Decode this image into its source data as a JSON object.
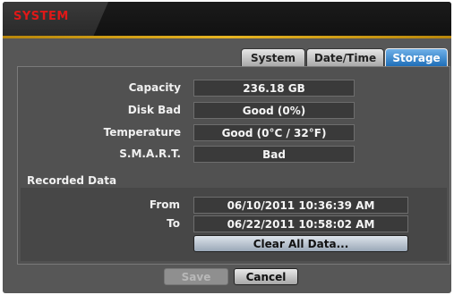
{
  "window": {
    "title": "SYSTEM"
  },
  "tabs": [
    {
      "label": "System",
      "active": false
    },
    {
      "label": "Date/Time",
      "active": false
    },
    {
      "label": "Storage",
      "active": true
    }
  ],
  "storage": {
    "capacity_label": "Capacity",
    "capacity_value": "236.18 GB",
    "disk_bad_label": "Disk Bad",
    "disk_bad_value": "Good (0%)",
    "temperature_label": "Temperature",
    "temperature_value": "Good (0°C / 32°F)",
    "smart_label": "S.M.A.R.T.",
    "smart_value": "Bad"
  },
  "recorded": {
    "section_title": "Recorded Data",
    "from_label": "From",
    "from_value": "06/10/2011  10:36:39 AM",
    "to_label": "To",
    "to_value": "06/22/2011  10:58:02 AM",
    "clear_label": "Clear All Data..."
  },
  "footer": {
    "save_label": "Save",
    "cancel_label": "Cancel"
  },
  "colors": {
    "title_red": "#e01818",
    "accent_gold": "#e6b422",
    "active_tab_blue": "#1f6fb8"
  }
}
